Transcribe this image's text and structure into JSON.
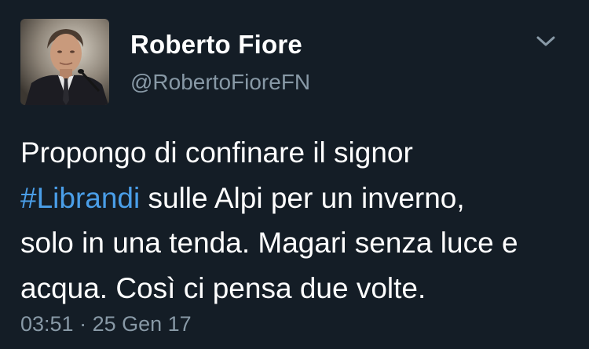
{
  "user": {
    "display_name": "Roberto Fiore",
    "handle": "@RobertoFioreFN"
  },
  "tweet": {
    "line1": "Propongo di confinare il signor",
    "hashtag": "#Librandi",
    "line2_rest": " sulle Alpi per un inverno,",
    "line3": "solo in una tenda. Magari senza luce e",
    "line4": "acqua. Così ci pensa due volte.",
    "hashtag_color": "#4a9ee8"
  },
  "meta": {
    "time": "03:51",
    "separator": " · ",
    "date": "25 Gen 17"
  },
  "icons": {
    "menu": "chevron-down-icon"
  },
  "colors": {
    "background": "#141d26",
    "secondary_text": "#8899a6",
    "primary_text": "#ffffff"
  }
}
